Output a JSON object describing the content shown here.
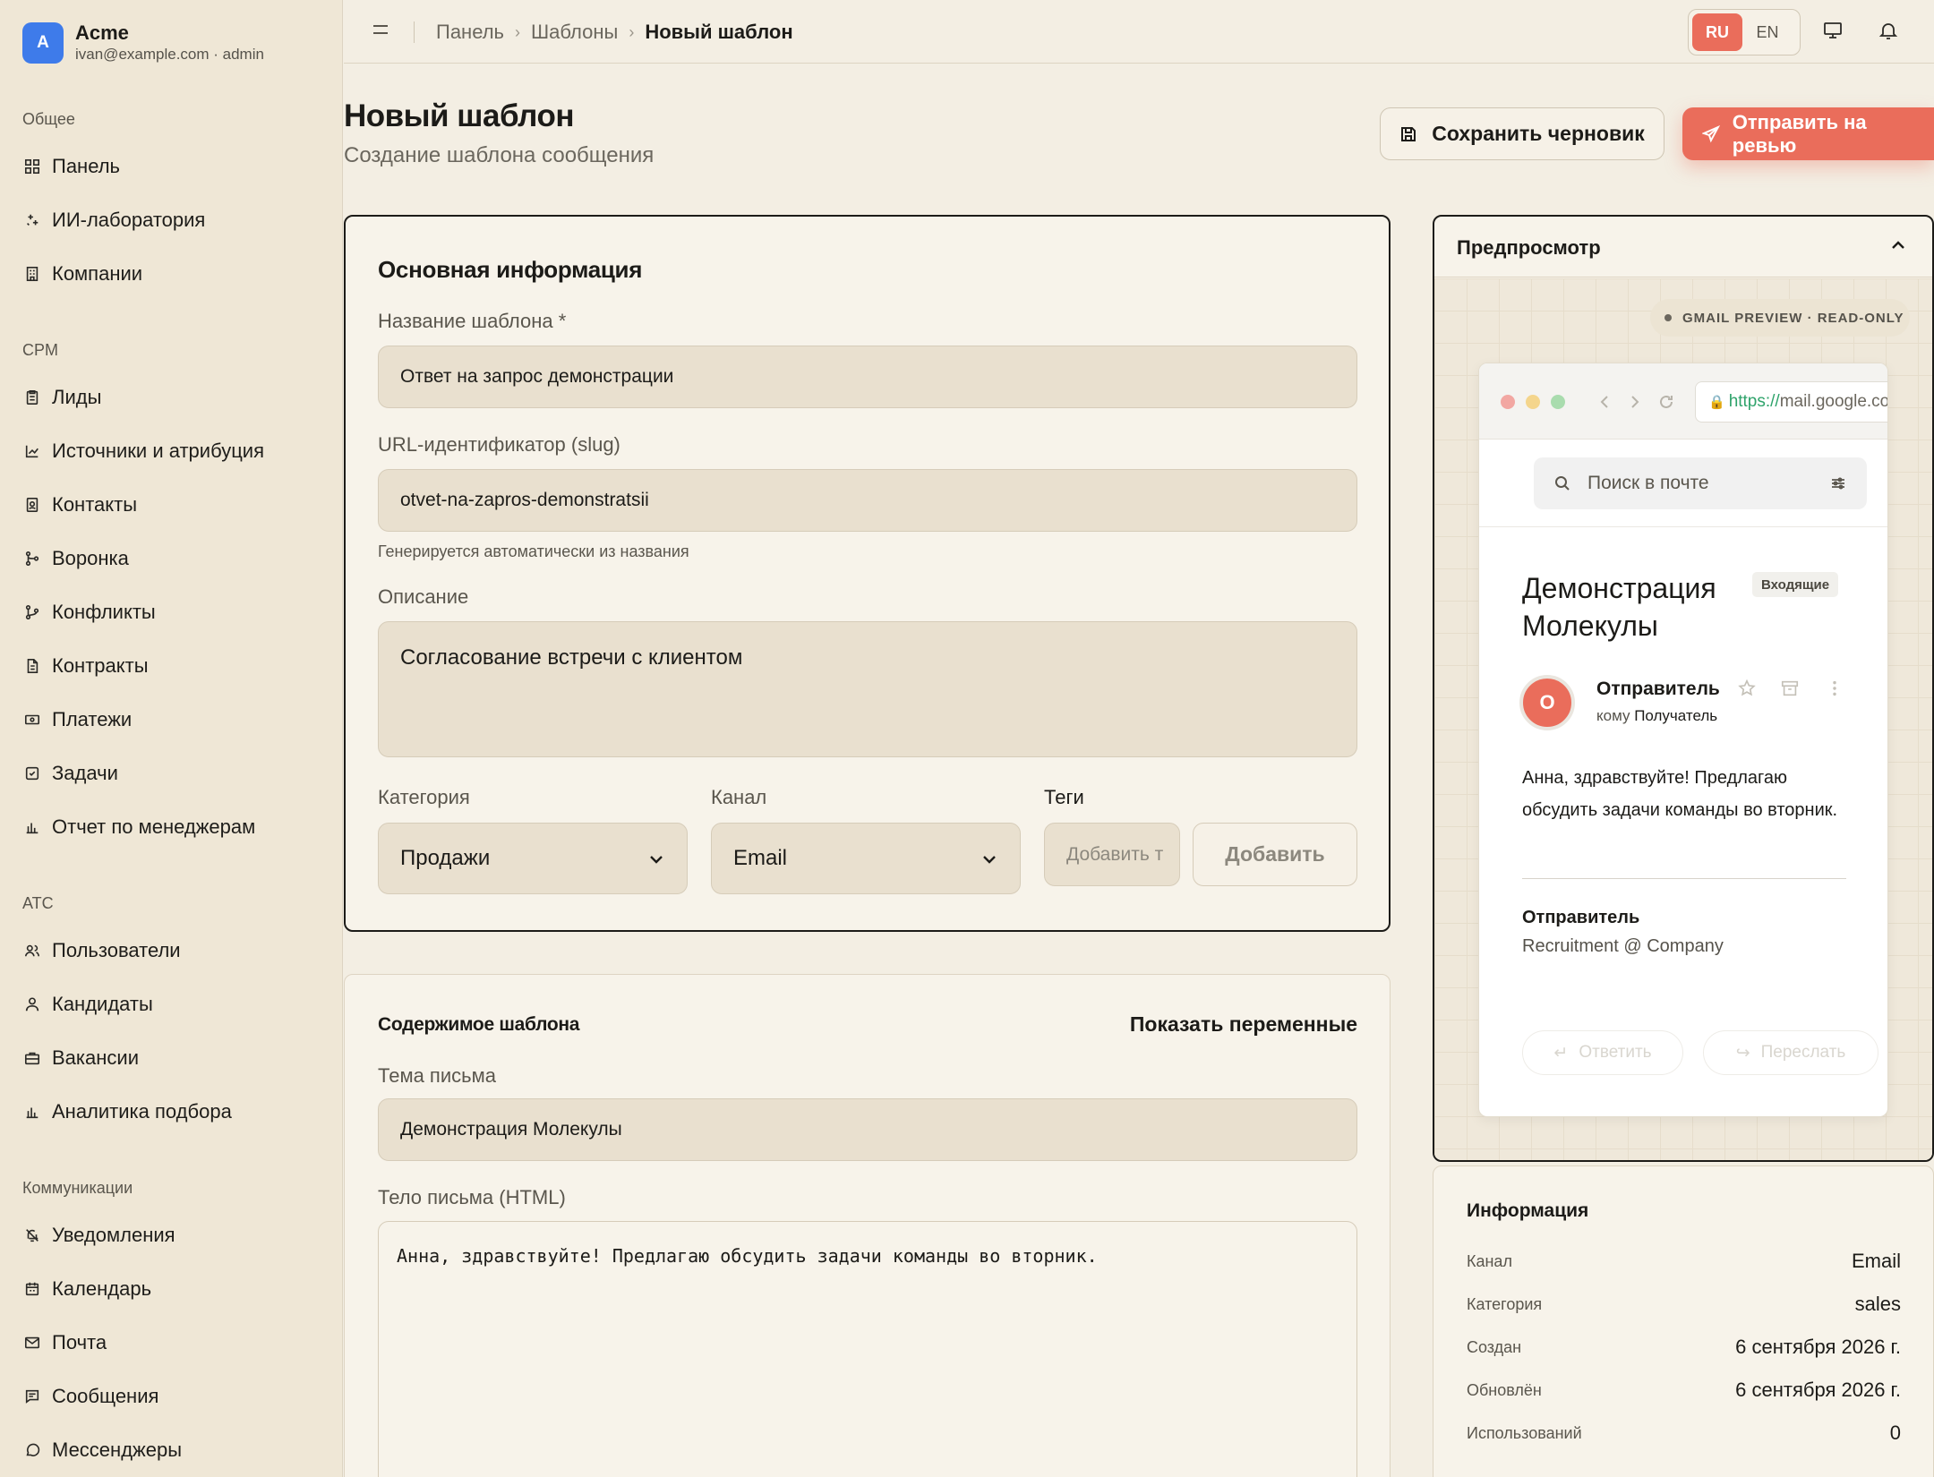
{
  "brand": {
    "initial": "A",
    "name": "Acme",
    "subtitle": "ivan@example.com · admin"
  },
  "sidebar": {
    "sections": [
      {
        "label": "Общее",
        "items": [
          "Панель",
          "ИИ-лаборатория",
          "Компании"
        ]
      },
      {
        "label": "CPM",
        "items": [
          "Лиды",
          "Источники и атрибуция",
          "Контакты",
          "Воронка",
          "Конфликты",
          "Контракты",
          "Платежи",
          "Задачи",
          "Отчет по менеджерам"
        ]
      },
      {
        "label": "ATC",
        "items": [
          "Пользователи",
          "Кандидаты",
          "Вакансии",
          "Аналитика подбора"
        ]
      },
      {
        "label": "Коммуникации",
        "items": [
          "Уведомления",
          "Календарь",
          "Почта",
          "Сообщения",
          "Мессенджеры"
        ]
      }
    ]
  },
  "topbar": {
    "breadcrumb": [
      "Панель",
      "Шаблоны",
      "Новый шаблон"
    ],
    "languages": [
      "RU",
      "EN"
    ],
    "active_language": "RU"
  },
  "header": {
    "title": "Новый шаблон",
    "subtitle": "Создание шаблона сообщения",
    "save_draft_label": "Сохранить черновик",
    "submit_review_label": "Отправить на ревью"
  },
  "basic_info": {
    "title": "Основная информация",
    "name_label": "Название шаблона *",
    "name_value": "Ответ на запрос демонстрации",
    "slug_label": "URL-идентификатор (slug)",
    "slug_value": "otvet-na-zapros-demonstratsii",
    "slug_hint": "Генерируется автоматически из названия",
    "description_label": "Описание",
    "description_value": "Согласование встречи с клиентом",
    "category_label": "Категория",
    "category_value": "Продажи",
    "channel_label": "Канал",
    "channel_value": "Email",
    "tags_label": "Теги",
    "tags_placeholder": "Добавить т",
    "tags_add_label": "Добавить"
  },
  "content": {
    "title": "Содержимое шаблона",
    "show_variables_label": "Показать переменные",
    "subject_label": "Тема письма",
    "subject_value": "Демонстрация Молекулы",
    "body_label": "Тело письма (HTML)",
    "body_value": "Анна, здравствуйте! Предлагаю обсудить задачи команды во вторник."
  },
  "preview": {
    "title": "Предпросмотр",
    "mode_badge": "GMAIL PREVIEW · READ-ONLY",
    "url_protocol": "https://",
    "url_host": "mail.google.com",
    "search_placeholder": "Поиск в почте",
    "subject": "Демонстрация Молекулы",
    "folder_badge": "Входящие",
    "avatar_initial": "О",
    "sender": "Отправитель",
    "to_prefix": "кому",
    "recipient": "Получатель",
    "body": "Анна, здравствуйте! Предлагаю обсудить задачи команды во вторник.",
    "signature_name": "Отправитель",
    "signature_company": "Recruitment @ Company",
    "reply_label": "Ответить",
    "forward_label": "Переслать"
  },
  "info": {
    "title": "Информация",
    "rows": [
      {
        "key": "Канал",
        "value": "Email"
      },
      {
        "key": "Категория",
        "value": "sales"
      },
      {
        "key": "Создан",
        "value": "6 сентября 2026 г."
      },
      {
        "key": "Обновлён",
        "value": "6 сентября 2026 г."
      },
      {
        "key": "Использований",
        "value": "0"
      }
    ]
  },
  "colors": {
    "accent": "#ea6d5b",
    "brand_avatar": "#3e7bea",
    "background": "#f3eee3",
    "sidebar": "#efe7d6"
  }
}
